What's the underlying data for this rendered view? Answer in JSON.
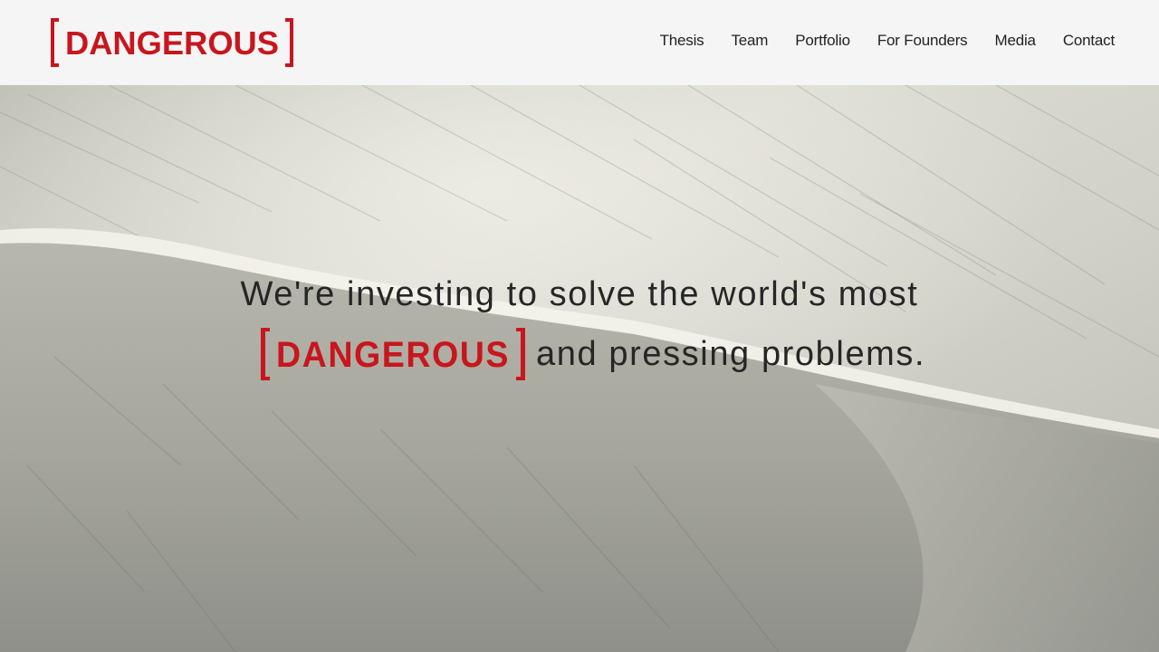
{
  "brand": {
    "name": "DANGEROUS",
    "color": "#c8161d"
  },
  "nav": {
    "items": [
      {
        "label": "Thesis"
      },
      {
        "label": "Team"
      },
      {
        "label": "Portfolio"
      },
      {
        "label": "For Founders"
      },
      {
        "label": "Media"
      },
      {
        "label": "Contact"
      }
    ]
  },
  "hero": {
    "line1": "We're investing to solve the world's most",
    "line2_suffix": "and pressing problems.",
    "inline_brand": "DANGEROUS",
    "background": "sand-dune-photo"
  },
  "colors": {
    "header_bg": "#f5f5f5",
    "text": "#262626",
    "accent": "#c8161d"
  }
}
